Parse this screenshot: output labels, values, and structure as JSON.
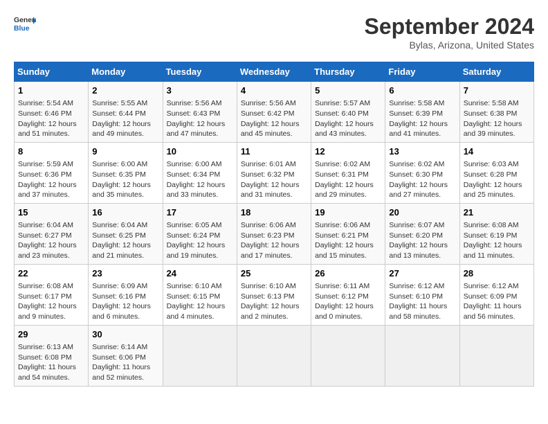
{
  "logo": {
    "line1": "General",
    "line2": "Blue"
  },
  "title": "September 2024",
  "subtitle": "Bylas, Arizona, United States",
  "days_of_week": [
    "Sunday",
    "Monday",
    "Tuesday",
    "Wednesday",
    "Thursday",
    "Friday",
    "Saturday"
  ],
  "weeks": [
    [
      {
        "day": "1",
        "info": "Sunrise: 5:54 AM\nSunset: 6:46 PM\nDaylight: 12 hours\nand 51 minutes."
      },
      {
        "day": "2",
        "info": "Sunrise: 5:55 AM\nSunset: 6:44 PM\nDaylight: 12 hours\nand 49 minutes."
      },
      {
        "day": "3",
        "info": "Sunrise: 5:56 AM\nSunset: 6:43 PM\nDaylight: 12 hours\nand 47 minutes."
      },
      {
        "day": "4",
        "info": "Sunrise: 5:56 AM\nSunset: 6:42 PM\nDaylight: 12 hours\nand 45 minutes."
      },
      {
        "day": "5",
        "info": "Sunrise: 5:57 AM\nSunset: 6:40 PM\nDaylight: 12 hours\nand 43 minutes."
      },
      {
        "day": "6",
        "info": "Sunrise: 5:58 AM\nSunset: 6:39 PM\nDaylight: 12 hours\nand 41 minutes."
      },
      {
        "day": "7",
        "info": "Sunrise: 5:58 AM\nSunset: 6:38 PM\nDaylight: 12 hours\nand 39 minutes."
      }
    ],
    [
      {
        "day": "8",
        "info": "Sunrise: 5:59 AM\nSunset: 6:36 PM\nDaylight: 12 hours\nand 37 minutes."
      },
      {
        "day": "9",
        "info": "Sunrise: 6:00 AM\nSunset: 6:35 PM\nDaylight: 12 hours\nand 35 minutes."
      },
      {
        "day": "10",
        "info": "Sunrise: 6:00 AM\nSunset: 6:34 PM\nDaylight: 12 hours\nand 33 minutes."
      },
      {
        "day": "11",
        "info": "Sunrise: 6:01 AM\nSunset: 6:32 PM\nDaylight: 12 hours\nand 31 minutes."
      },
      {
        "day": "12",
        "info": "Sunrise: 6:02 AM\nSunset: 6:31 PM\nDaylight: 12 hours\nand 29 minutes."
      },
      {
        "day": "13",
        "info": "Sunrise: 6:02 AM\nSunset: 6:30 PM\nDaylight: 12 hours\nand 27 minutes."
      },
      {
        "day": "14",
        "info": "Sunrise: 6:03 AM\nSunset: 6:28 PM\nDaylight: 12 hours\nand 25 minutes."
      }
    ],
    [
      {
        "day": "15",
        "info": "Sunrise: 6:04 AM\nSunset: 6:27 PM\nDaylight: 12 hours\nand 23 minutes."
      },
      {
        "day": "16",
        "info": "Sunrise: 6:04 AM\nSunset: 6:25 PM\nDaylight: 12 hours\nand 21 minutes."
      },
      {
        "day": "17",
        "info": "Sunrise: 6:05 AM\nSunset: 6:24 PM\nDaylight: 12 hours\nand 19 minutes."
      },
      {
        "day": "18",
        "info": "Sunrise: 6:06 AM\nSunset: 6:23 PM\nDaylight: 12 hours\nand 17 minutes."
      },
      {
        "day": "19",
        "info": "Sunrise: 6:06 AM\nSunset: 6:21 PM\nDaylight: 12 hours\nand 15 minutes."
      },
      {
        "day": "20",
        "info": "Sunrise: 6:07 AM\nSunset: 6:20 PM\nDaylight: 12 hours\nand 13 minutes."
      },
      {
        "day": "21",
        "info": "Sunrise: 6:08 AM\nSunset: 6:19 PM\nDaylight: 12 hours\nand 11 minutes."
      }
    ],
    [
      {
        "day": "22",
        "info": "Sunrise: 6:08 AM\nSunset: 6:17 PM\nDaylight: 12 hours\nand 9 minutes."
      },
      {
        "day": "23",
        "info": "Sunrise: 6:09 AM\nSunset: 6:16 PM\nDaylight: 12 hours\nand 6 minutes."
      },
      {
        "day": "24",
        "info": "Sunrise: 6:10 AM\nSunset: 6:15 PM\nDaylight: 12 hours\nand 4 minutes."
      },
      {
        "day": "25",
        "info": "Sunrise: 6:10 AM\nSunset: 6:13 PM\nDaylight: 12 hours\nand 2 minutes."
      },
      {
        "day": "26",
        "info": "Sunrise: 6:11 AM\nSunset: 6:12 PM\nDaylight: 12 hours\nand 0 minutes."
      },
      {
        "day": "27",
        "info": "Sunrise: 6:12 AM\nSunset: 6:10 PM\nDaylight: 11 hours\nand 58 minutes."
      },
      {
        "day": "28",
        "info": "Sunrise: 6:12 AM\nSunset: 6:09 PM\nDaylight: 11 hours\nand 56 minutes."
      }
    ],
    [
      {
        "day": "29",
        "info": "Sunrise: 6:13 AM\nSunset: 6:08 PM\nDaylight: 11 hours\nand 54 minutes."
      },
      {
        "day": "30",
        "info": "Sunrise: 6:14 AM\nSunset: 6:06 PM\nDaylight: 11 hours\nand 52 minutes."
      },
      {
        "day": "",
        "info": ""
      },
      {
        "day": "",
        "info": ""
      },
      {
        "day": "",
        "info": ""
      },
      {
        "day": "",
        "info": ""
      },
      {
        "day": "",
        "info": ""
      }
    ]
  ]
}
